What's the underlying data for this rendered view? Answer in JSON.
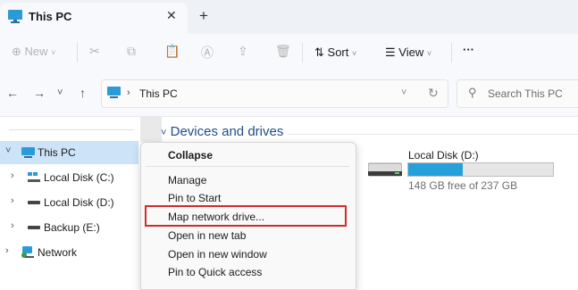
{
  "tab": {
    "title": "This PC",
    "close": "✕",
    "new": "+"
  },
  "toolbar": {
    "new_label": "New",
    "sort_label": "Sort",
    "view_label": "View",
    "more_label": "···"
  },
  "address": {
    "crumb": "This PC",
    "search_placeholder": "Search This PC"
  },
  "sidebar": {
    "items": [
      {
        "label": "This PC"
      },
      {
        "label": "Local Disk (C:)"
      },
      {
        "label": "Local Disk (D:)"
      },
      {
        "label": "Backup (E:)"
      },
      {
        "label": "Network"
      }
    ]
  },
  "content": {
    "group_header": "Devices and drives",
    "drive": {
      "name": "Local Disk (D:)",
      "free_text": "148 GB free of 237 GB",
      "used_fraction": 0.376
    }
  },
  "context_menu": {
    "title": "Collapse",
    "items": [
      "Manage",
      "Pin to Start",
      "Map network drive...",
      "Open in new tab",
      "Open in new window",
      "Pin to Quick access"
    ]
  },
  "colors": {
    "accent": "#26a0da",
    "highlight": "#d12b2b",
    "selected": "#cde3f7"
  }
}
